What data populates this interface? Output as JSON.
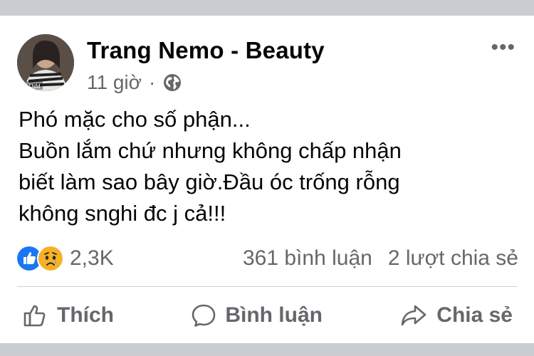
{
  "post": {
    "author": "Trang Nemo - Beauty",
    "time": "11 giờ",
    "separator": "·",
    "privacy_icon": "globe-icon",
    "more_label": "•••",
    "avatar_text": "TNM",
    "body_lines": [
      "Phó mặc cho số phận...",
      "Buồn lắm chứ nhưng không chấp nhận",
      "biết làm sao bây giờ.Đầu óc trống rỗng",
      "không snghi đc j cả!!!"
    ]
  },
  "stats": {
    "reaction_icons": [
      "like-reaction-icon",
      "sad-reaction-icon"
    ],
    "reactions_count": "2,3K",
    "comments": "361 bình luận",
    "shares": "2 lượt chia sẻ"
  },
  "actions": [
    {
      "label": "Thích",
      "icon": "thumbs-up-icon"
    },
    {
      "label": "Bình luận",
      "icon": "comment-bubble-icon"
    },
    {
      "label": "Chia sẻ",
      "icon": "share-arrow-icon"
    }
  ],
  "colors": {
    "background": "#c9ccd1",
    "card": "#ffffff",
    "primary_text": "#050505",
    "secondary_text": "#65676b",
    "like_blue": "#1877f2",
    "sad_yellow": "#f7b125"
  }
}
